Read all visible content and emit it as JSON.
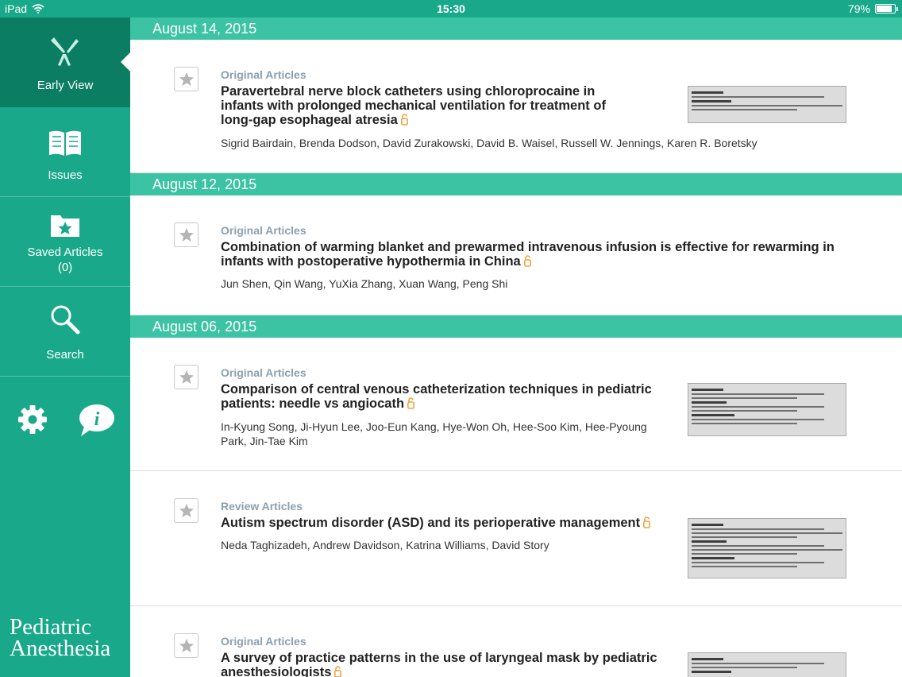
{
  "status_bar": {
    "device": "iPad",
    "time": "15:30",
    "battery": "79%",
    "battery_level": 0.79
  },
  "sidebar": {
    "items": [
      {
        "label": "Early View"
      },
      {
        "label": "Issues"
      },
      {
        "label": "Saved Articles",
        "count": "(0)"
      },
      {
        "label": "Search"
      }
    ],
    "journal_name_line1": "Pediatric",
    "journal_name_line2": "Anesthesia"
  },
  "groups": [
    {
      "date": "August 14, 2015"
    },
    {
      "date": "August 12, 2015"
    },
    {
      "date": "August 06, 2015"
    }
  ],
  "articles": [
    {
      "category": "Original Articles",
      "title": "Paravertebral nerve block catheters using chloroprocaine in infants with prolonged mechanical ventilation for treatment of long-gap esophageal atresia",
      "authors": "Sigrid Bairdain, Brenda Dodson, David Zurakowski, David B. Waisel, Russell W. Jennings, Karen R. Boretsky"
    },
    {
      "category": "Original Articles",
      "title": "Combination of warming blanket and prewarmed intravenous infusion is effective for rewarming in infants with postoperative hypothermia in China",
      "authors": "Jun Shen, Qin Wang, YuXia Zhang, Xuan Wang, Peng Shi"
    },
    {
      "category": "Original Articles",
      "title": "Comparison of central venous catheterization techniques in pediatric patients: needle vs angiocath",
      "authors": "In-Kyung Song, Ji-Hyun Lee, Joo-Eun Kang, Hye-Won Oh, Hee-Soo Kim, Hee-Pyoung Park, Jin-Tae Kim"
    },
    {
      "category": "Review Articles",
      "title": "Autism spectrum disorder (ASD) and its perioperative management",
      "authors": "Neda Taghizadeh, Andrew Davidson, Katrina Williams, David Story"
    },
    {
      "category": "Original Articles",
      "title": "A survey of practice patterns in the use of laryngeal mask by pediatric anesthesiologists",
      "authors": ""
    }
  ],
  "colors": {
    "sidebar": "#19a98a",
    "sidebar_active": "#0b7d63",
    "date_bar": "#3cc3a3",
    "category": "#8aa0b0",
    "lock": "#f0a23c"
  }
}
